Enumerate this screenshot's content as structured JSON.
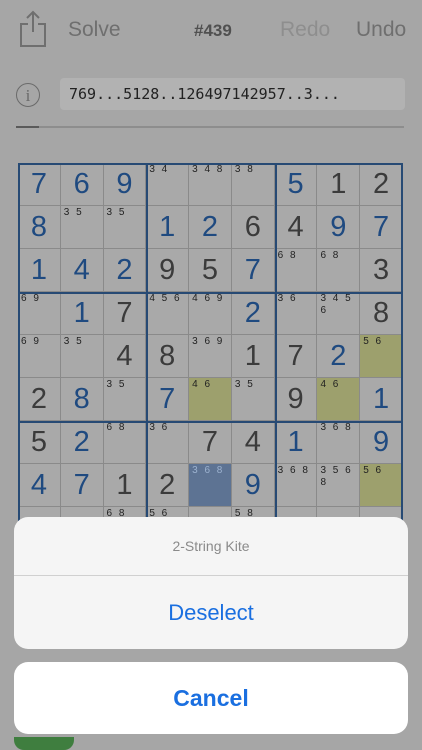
{
  "toolbar": {
    "share_icon": "share-icon",
    "solve_label": "Solve",
    "puzzle_number": "#439",
    "redo_label": "Redo",
    "undo_label": "Undo"
  },
  "info": {
    "icon_glyph": "i",
    "puzzle_string": "769...5128..126497142957..3..."
  },
  "progress": {
    "fraction": 0.06
  },
  "board": {
    "rows": [
      [
        {
          "v": "7",
          "t": "s"
        },
        {
          "v": "6",
          "t": "s"
        },
        {
          "v": "9",
          "t": "s"
        },
        {
          "c": "3 4"
        },
        {
          "c": "3 4 8"
        },
        {
          "c": "3 8"
        },
        {
          "v": "5",
          "t": "s"
        },
        {
          "v": "1",
          "t": "g"
        },
        {
          "v": "2",
          "t": "g"
        }
      ],
      [
        {
          "v": "8",
          "t": "s"
        },
        {
          "c": "3 5"
        },
        {
          "c": "3 5"
        },
        {
          "v": "1",
          "t": "s"
        },
        {
          "v": "2",
          "t": "s"
        },
        {
          "v": "6",
          "t": "g"
        },
        {
          "v": "4",
          "t": "g"
        },
        {
          "v": "9",
          "t": "s"
        },
        {
          "v": "7",
          "t": "s"
        }
      ],
      [
        {
          "v": "1",
          "t": "s"
        },
        {
          "v": "4",
          "t": "s"
        },
        {
          "v": "2",
          "t": "s"
        },
        {
          "v": "9",
          "t": "g"
        },
        {
          "v": "5",
          "t": "g"
        },
        {
          "v": "7",
          "t": "s"
        },
        {
          "c": "6 8"
        },
        {
          "c": "6 8"
        },
        {
          "v": "3",
          "t": "g"
        }
      ],
      [
        {
          "c": "6 9"
        },
        {
          "v": "1",
          "t": "s"
        },
        {
          "v": "7",
          "t": "g"
        },
        {
          "c": "4 5 6"
        },
        {
          "c": "4 6 9"
        },
        {
          "v": "2",
          "t": "s"
        },
        {
          "c": "3 6"
        },
        {
          "c": "3 4 5 6"
        },
        {
          "v": "8",
          "t": "g"
        }
      ],
      [
        {
          "c": "6 9"
        },
        {
          "c": "3 5"
        },
        {
          "v": "4",
          "t": "g"
        },
        {
          "v": "8",
          "t": "g"
        },
        {
          "c": "3 6 9"
        },
        {
          "v": "1",
          "t": "g"
        },
        {
          "v": "7",
          "t": "g"
        },
        {
          "v": "2",
          "t": "s"
        },
        {
          "c": "5 6",
          "h": 1
        }
      ],
      [
        {
          "v": "2",
          "t": "g"
        },
        {
          "v": "8",
          "t": "s"
        },
        {
          "c": "3 5"
        },
        {
          "v": "7",
          "t": "s"
        },
        {
          "c": "4 6",
          "h": 1
        },
        {
          "c": "3 5"
        },
        {
          "v": "9",
          "t": "g"
        },
        {
          "c": "4 6",
          "h": 1
        },
        {
          "v": "1",
          "t": "s"
        }
      ],
      [
        {
          "v": "5",
          "t": "g"
        },
        {
          "v": "2",
          "t": "s"
        },
        {
          "c": "6 8"
        },
        {
          "c": "3 6"
        },
        {
          "v": "7",
          "t": "g"
        },
        {
          "v": "4",
          "t": "g"
        },
        {
          "v": "1",
          "t": "s"
        },
        {
          "c": "3 6 8"
        },
        {
          "v": "9",
          "t": "s"
        }
      ],
      [
        {
          "v": "4",
          "t": "s"
        },
        {
          "v": "7",
          "t": "s"
        },
        {
          "v": "1",
          "t": "g"
        },
        {
          "v": "2",
          "t": "g"
        },
        {
          "c": "3 6 8",
          "sel": 1
        },
        {
          "v": "9",
          "t": "s"
        },
        {
          "c": "3 6 8"
        },
        {
          "c": "3 5 6 8"
        },
        {
          "c": "5 6",
          "h": 1
        }
      ],
      [
        {
          "v": "",
          "t": "g"
        },
        {
          "v": "",
          "t": "g"
        },
        {
          "c": "6 8"
        },
        {
          "c": "5 6"
        },
        {
          "v": "",
          "t": "s"
        },
        {
          "c": "5 8"
        },
        {
          "v": "",
          "t": "s"
        },
        {
          "v": "",
          "t": "s"
        },
        {
          "v": "",
          "t": "s"
        }
      ]
    ]
  },
  "sheet": {
    "title": "2-String Kite",
    "action_label": "Deselect",
    "cancel_label": "Cancel"
  },
  "colors": {
    "accent": "#1a6fe0",
    "solved_digit": "#1f4a80",
    "given_digit": "#3b3b3b",
    "box_line": "#274a74",
    "highlight": "#9da06d",
    "selected": "#5d7393"
  }
}
